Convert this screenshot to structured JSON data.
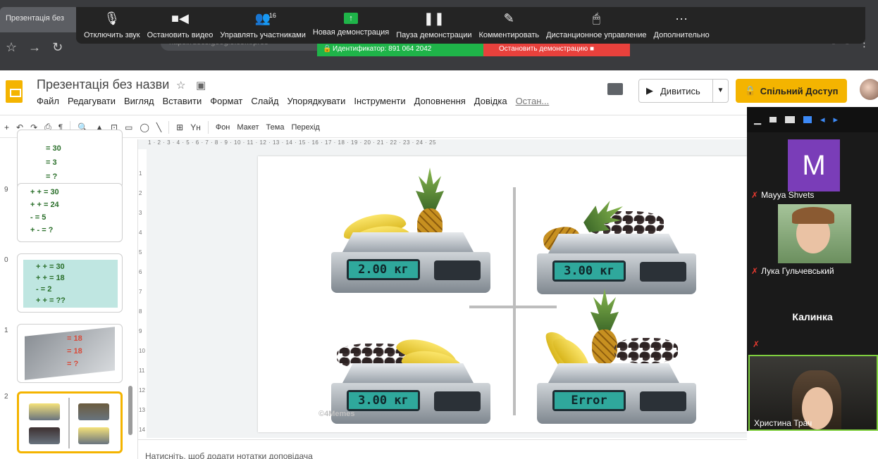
{
  "browser": {
    "tab_title": "Презентація без",
    "address_dim": "https://docs.google.com/pres",
    "address_bold": "docs.google.com"
  },
  "zoom_toolbar": {
    "items": [
      {
        "label": "Отключить звук",
        "icon": "microphone-icon"
      },
      {
        "label": "Остановить видео",
        "icon": "video-camera-icon"
      },
      {
        "label": "Управлять участниками",
        "icon": "participants-icon",
        "count": "16"
      },
      {
        "label": "Новая демонстрация",
        "icon": "share-screen-icon"
      },
      {
        "label": "Пауза демонстрации",
        "icon": "pause-icon"
      },
      {
        "label": "Комментировать",
        "icon": "pen-icon"
      },
      {
        "label": "Дистанционное управление",
        "icon": "mouse-icon"
      },
      {
        "label": "Дополнительно",
        "icon": "more-icon"
      }
    ],
    "meeting_id": "Идентификатор: 891 064 2042",
    "stop_share": "Остановить демонстрацию"
  },
  "slides": {
    "title": "Презентація без назви",
    "menu": [
      "Файл",
      "Редагувати",
      "Вигляд",
      "Вставити",
      "Формат",
      "Слайд",
      "Упорядкувати",
      "Інструменти",
      "Доповнення",
      "Довідка",
      "Остан..."
    ],
    "present_label": "Дивитись",
    "share_label": "Спільний Доступ",
    "toolbar_text": {
      "bg": "Фон",
      "layout": "Макет",
      "theme": "Тема",
      "transition": "Перехід"
    },
    "ruler_marks": "1 · 2 · 3 · 4 · 5 · 6 · 7 · 8 · 9 · 10 · 11 · 12 · 13 · 14 · 15 · 16 · 17 · 18 · 19 · 20 · 21 · 22 · 23 · 24 · 25",
    "ruler_left_marks": [
      "1",
      "2",
      "3",
      "4",
      "5",
      "6",
      "7",
      "8",
      "9",
      "10",
      "11",
      "12",
      "13",
      "14"
    ],
    "notes_placeholder": "Натисніть, щоб додати нотатки доповідача"
  },
  "filmstrip": {
    "slides": [
      {
        "num": "9",
        "lines": [
          "+ + = 30",
          "+ + = 24",
          "- = 5",
          "+ - = ?"
        ]
      },
      {
        "num": "0",
        "lines": [
          "+ + = 30",
          "+ + = 18",
          "- = 2",
          "+ + = ??"
        ]
      },
      {
        "num": "1",
        "lines": [
          "= 18",
          "= 18",
          "= ?"
        ]
      },
      {
        "num": "2",
        "lines": []
      }
    ],
    "top_partial_lines": [
      "= 30",
      "= 3",
      "= ?"
    ]
  },
  "slide_content": {
    "scales": [
      {
        "reading": "2.00 кг"
      },
      {
        "reading": "3.00 кг"
      },
      {
        "reading": "3.00 кг"
      },
      {
        "reading": "Error"
      }
    ],
    "watermark": "©4Memes"
  },
  "participants": [
    {
      "name": "Mayya Shvets",
      "initial": "M"
    },
    {
      "name": "Лука Гульчевський"
    },
    {
      "name": "Калинка"
    },
    {
      "name": "Христина Трач"
    }
  ]
}
